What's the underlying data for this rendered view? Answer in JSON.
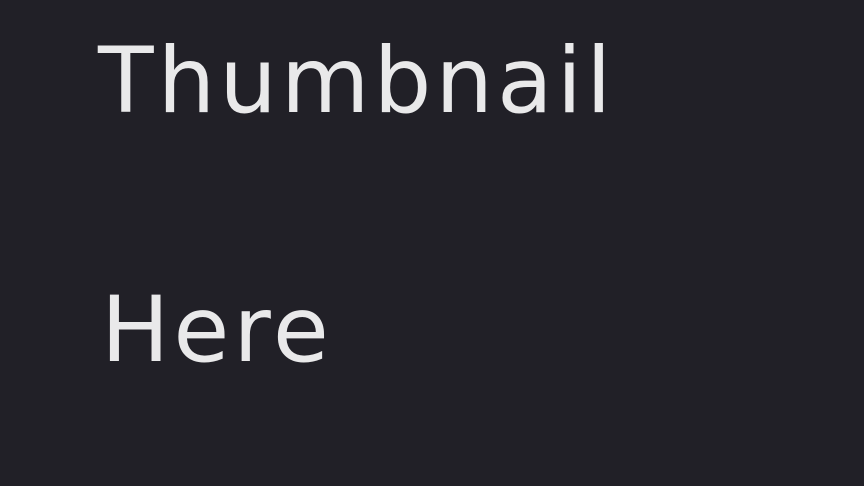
{
  "thumbnail": {
    "background_color": "#212027",
    "text_color": "#e9e9ea",
    "lines": [
      "Thumbnail",
      "Here"
    ]
  }
}
